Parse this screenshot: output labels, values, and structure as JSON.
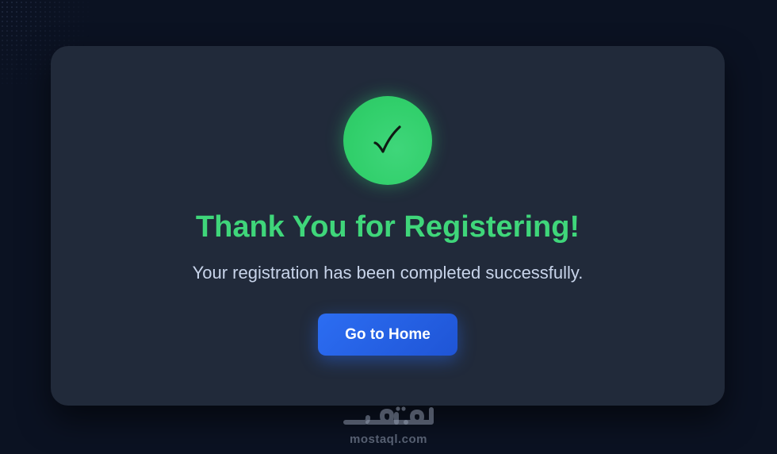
{
  "card": {
    "icon": "checkmark-icon",
    "title": "Thank You for Registering!",
    "message": "Your registration has been completed successfully.",
    "button_label": "Go to Home"
  },
  "watermark": {
    "logo": "مستقل",
    "domain": "mostaql.com"
  },
  "colors": {
    "background": "#0b1222",
    "card": "#212a3a",
    "success": "#3fd67a",
    "button": "#2563eb",
    "message": "#c8d4ea"
  }
}
